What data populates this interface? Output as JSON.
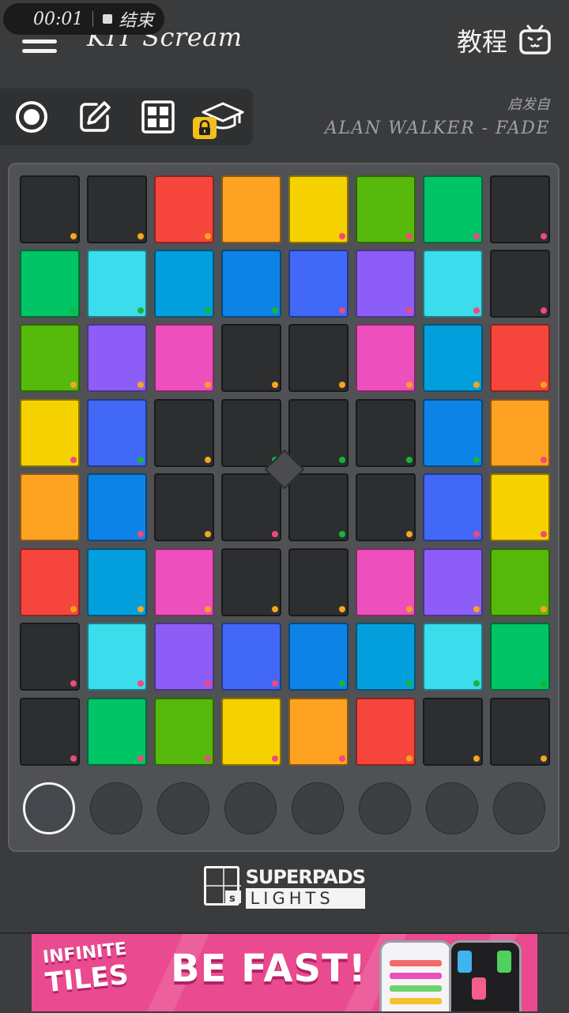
{
  "recording": {
    "time": "00:01",
    "stop_label": "结束"
  },
  "header": {
    "title": "KIT Scream",
    "tutorial_label": "教程"
  },
  "song": {
    "label": "启发自",
    "name": "ALAN WALKER - FADE"
  },
  "toolbar": {
    "tools": [
      "record-icon",
      "edit-icon",
      "grid-icon",
      "tutorial-cap-icon"
    ],
    "locked_tool": "tutorial-cap-icon"
  },
  "pads": {
    "rows": [
      [
        {
          "c": "#2d2e30",
          "d": "o"
        },
        {
          "c": "#2d2e30",
          "d": "o"
        },
        {
          "c": "#f6453c",
          "d": "o"
        },
        {
          "c": "#fea221",
          "d": "o"
        },
        {
          "c": "#f6d100",
          "d": "p"
        },
        {
          "c": "#56b90c",
          "d": "p"
        },
        {
          "c": "#00c465",
          "d": "p"
        },
        {
          "c": "#2d2e30",
          "d": "p"
        }
      ],
      [
        {
          "c": "#00c465",
          "d": "g"
        },
        {
          "c": "#3bdcec",
          "d": "g"
        },
        {
          "c": "#039fdd",
          "d": "g"
        },
        {
          "c": "#0d83e8",
          "d": "g"
        },
        {
          "c": "#4268f7",
          "d": "p"
        },
        {
          "c": "#8d5df7",
          "d": "p"
        },
        {
          "c": "#3bdcec",
          "d": "p"
        },
        {
          "c": "#2d2e30",
          "d": "p"
        }
      ],
      [
        {
          "c": "#56b90c",
          "d": "o"
        },
        {
          "c": "#8d5df7",
          "d": "o"
        },
        {
          "c": "#ed4fbd",
          "d": "o"
        },
        {
          "c": "#2d2e30",
          "d": "o"
        },
        {
          "c": "#2d2e30",
          "d": "o"
        },
        {
          "c": "#ed4fbd",
          "d": "o"
        },
        {
          "c": "#039fdd",
          "d": "o"
        },
        {
          "c": "#f6453c",
          "d": "o"
        }
      ],
      [
        {
          "c": "#f6d100",
          "d": "p"
        },
        {
          "c": "#4268f7",
          "d": "g"
        },
        {
          "c": "#2d2e30",
          "d": "o"
        },
        {
          "c": "#2d2e30",
          "d": "g"
        },
        {
          "c": "#2d2e30",
          "d": "g"
        },
        {
          "c": "#2d2e30",
          "d": "g"
        },
        {
          "c": "#0d83e8",
          "d": "g"
        },
        {
          "c": "#fea221",
          "d": "p"
        }
      ],
      [
        {
          "c": "#fea221",
          "d": "o"
        },
        {
          "c": "#0d83e8",
          "d": "p"
        },
        {
          "c": "#2d2e30",
          "d": "o"
        },
        {
          "c": "#2d2e30",
          "d": "p"
        },
        {
          "c": "#2d2e30",
          "d": "g"
        },
        {
          "c": "#2d2e30",
          "d": "o"
        },
        {
          "c": "#4268f7",
          "d": "p"
        },
        {
          "c": "#f6d100",
          "d": "p"
        }
      ],
      [
        {
          "c": "#f6453c",
          "d": "o"
        },
        {
          "c": "#039fdd",
          "d": "o"
        },
        {
          "c": "#ed4fbd",
          "d": "o"
        },
        {
          "c": "#2d2e30",
          "d": "o"
        },
        {
          "c": "#2d2e30",
          "d": "o"
        },
        {
          "c": "#ed4fbd",
          "d": "o"
        },
        {
          "c": "#8d5df7",
          "d": "o"
        },
        {
          "c": "#56b90c",
          "d": "o"
        }
      ],
      [
        {
          "c": "#2d2e30",
          "d": "p"
        },
        {
          "c": "#3bdcec",
          "d": "p"
        },
        {
          "c": "#8d5df7",
          "d": "p"
        },
        {
          "c": "#4268f7",
          "d": "p"
        },
        {
          "c": "#0d83e8",
          "d": "g"
        },
        {
          "c": "#039fdd",
          "d": "g"
        },
        {
          "c": "#3bdcec",
          "d": "g"
        },
        {
          "c": "#00c465",
          "d": "g"
        }
      ],
      [
        {
          "c": "#2d2e30",
          "d": "p"
        },
        {
          "c": "#00c465",
          "d": "p"
        },
        {
          "c": "#56b90c",
          "d": "p"
        },
        {
          "c": "#f6d100",
          "d": "p"
        },
        {
          "c": "#fea221",
          "d": "p"
        },
        {
          "c": "#f6453c",
          "d": "o"
        },
        {
          "c": "#2d2e30",
          "d": "o"
        },
        {
          "c": "#2d2e30",
          "d": "o"
        }
      ]
    ],
    "dot_colors": {
      "o": "#f7a51e",
      "p": "#f0497a",
      "g": "#17b53a"
    }
  },
  "scene_buttons": {
    "count": 8,
    "active_index": 0
  },
  "brand": {
    "top": "SUPERPADS",
    "bottom": "LIGHTS"
  },
  "ad": {
    "brand_line1": "INFINITE",
    "brand_line2": "TILES",
    "headline": "BE FAST!"
  }
}
